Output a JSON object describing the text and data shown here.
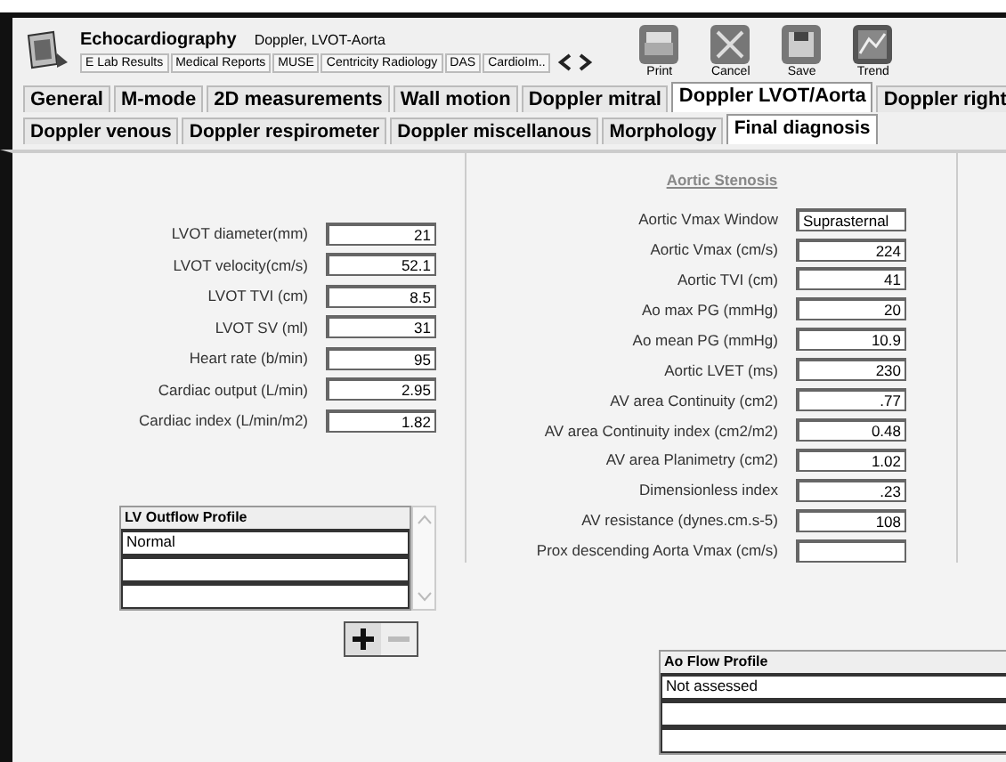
{
  "header": {
    "title": "Echocardiography",
    "subtitle": "Doppler, LVOT-Aorta"
  },
  "app_tabs": [
    {
      "label": "E Lab Results",
      "selected": false
    },
    {
      "label": "Medical Reports",
      "selected": false
    },
    {
      "label": "MUSE",
      "selected": false
    },
    {
      "label": "Centricity Radiology",
      "selected": false
    },
    {
      "label": "DAS",
      "selected": false
    },
    {
      "label": "CardioIm..",
      "selected": false
    }
  ],
  "toolbar": [
    {
      "label": "Print",
      "kind": "print"
    },
    {
      "label": "Cancel",
      "kind": "cancel"
    },
    {
      "label": "Save",
      "kind": "save"
    },
    {
      "label": "Trend",
      "kind": "trend"
    }
  ],
  "tabs": [
    {
      "label": "General",
      "selected": false
    },
    {
      "label": "M-mode",
      "selected": false
    },
    {
      "label": "2D measurements",
      "selected": false
    },
    {
      "label": "Wall motion",
      "selected": false
    },
    {
      "label": "Doppler mitral",
      "selected": false
    },
    {
      "label": "Doppler LVOT/Aorta",
      "selected": true
    },
    {
      "label": "Doppler right",
      "selected": false
    }
  ],
  "subtabs": [
    {
      "label": "Doppler venous",
      "selected": false
    },
    {
      "label": "Doppler respirometer",
      "selected": false
    },
    {
      "label": "Doppler miscellanous",
      "selected": false
    },
    {
      "label": "Morphology",
      "selected": false
    },
    {
      "label": "Final diagnosis",
      "selected": true
    }
  ],
  "left_fields": [
    {
      "label": "LVOT diameter(mm)",
      "value": "21"
    },
    {
      "label": "LVOT velocity(cm/s)",
      "value": "52.1"
    },
    {
      "label": "LVOT TVI (cm)",
      "value": "8.5"
    },
    {
      "label": "LVOT SV (ml)",
      "value": "31"
    },
    {
      "label": "Heart rate (b/min)",
      "value": "95"
    },
    {
      "label": "Cardiac output (L/min)",
      "value": "2.95"
    },
    {
      "label": "Cardiac index (L/min/m2)",
      "value": "1.82"
    }
  ],
  "section_title": "Aortic Stenosis",
  "right_fields": [
    {
      "label": "Aortic Vmax Window",
      "value": "Suprasternal",
      "kind": "text"
    },
    {
      "label": "Aortic Vmax (cm/s)",
      "value": "224",
      "kind": "number"
    },
    {
      "label": "Aortic TVI (cm)",
      "value": "41",
      "kind": "number"
    },
    {
      "label": "Ao max PG (mmHg)",
      "value": "20",
      "kind": "number"
    },
    {
      "label": "Ao mean PG (mmHg)",
      "value": "10.9",
      "kind": "number"
    },
    {
      "label": "Aortic LVET (ms)",
      "value": "230",
      "kind": "number"
    },
    {
      "label": "AV area Continuity (cm2)",
      "value": ".77",
      "kind": "number"
    },
    {
      "label": "AV area Continuity index (cm2/m2)",
      "value": "0.48",
      "kind": "number"
    },
    {
      "label": "AV area Planimetry (cm2)",
      "value": "1.02",
      "kind": "number"
    },
    {
      "label": "Dimensionless index",
      "value": ".23",
      "kind": "number"
    },
    {
      "label": "AV resistance (dynes.cm.s-5)",
      "value": "108",
      "kind": "number"
    },
    {
      "label": "Prox descending Aorta Vmax (cm/s)",
      "kind": "number"
    }
  ],
  "lv_outflow_profile": {
    "title": "LV Outflow Profile",
    "rows": [
      "Normal"
    ]
  },
  "ao_flow_profile": {
    "title": "Ao Flow Profile",
    "rows": [
      "Not assessed"
    ]
  }
}
